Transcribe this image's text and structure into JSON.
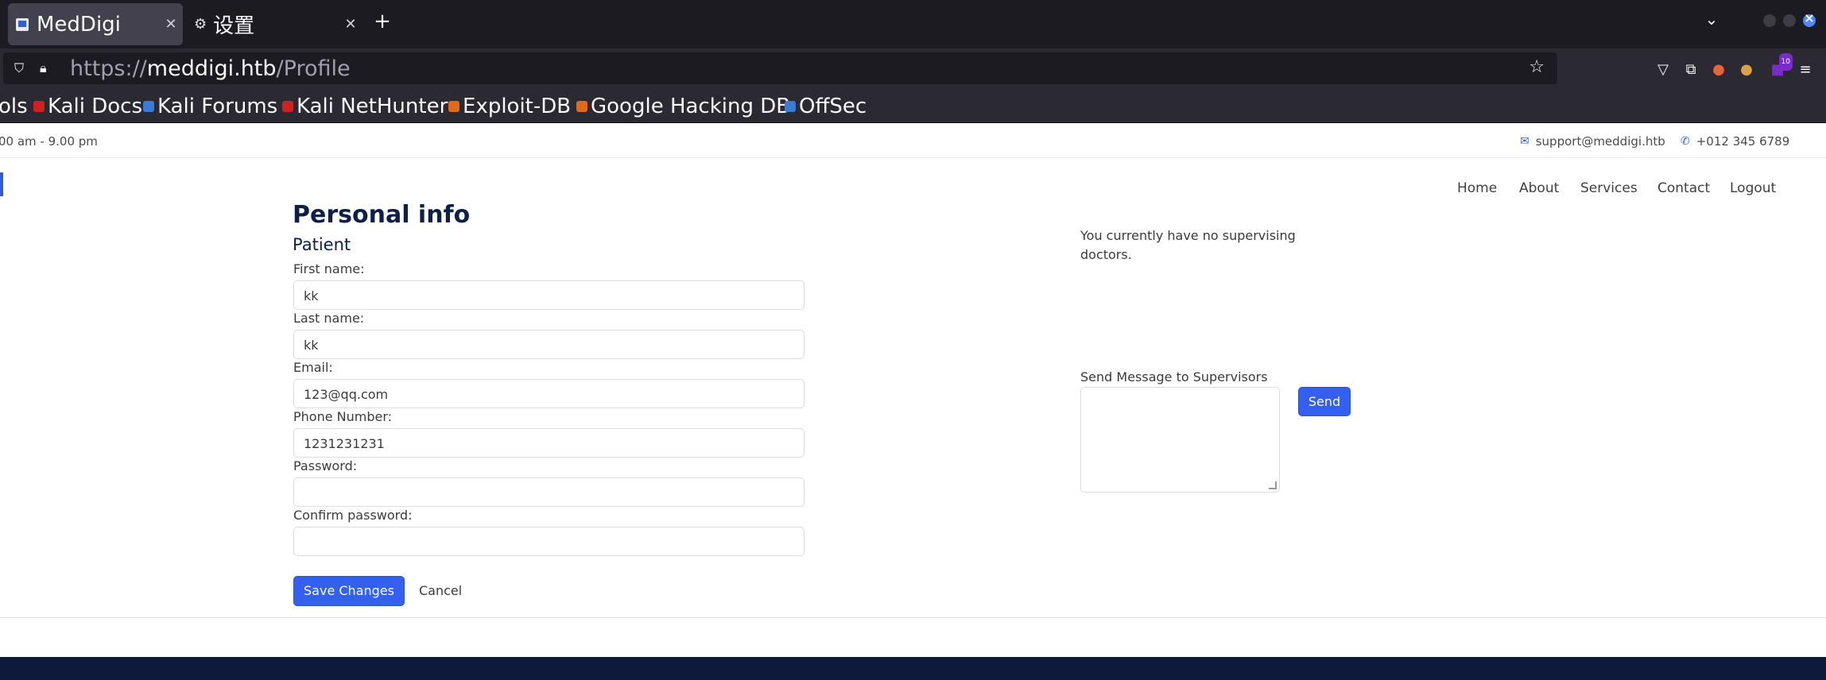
{
  "browser": {
    "tabs": [
      {
        "title": "MedDigi",
        "active": true
      },
      {
        "title": "设置",
        "active": false
      }
    ],
    "url_scheme": "https://",
    "url_host": "meddigi.htb",
    "url_path": "/Profile",
    "bookmarks": [
      {
        "label": "ols",
        "color": ""
      },
      {
        "label": "Kali Docs",
        "color": "#d02020"
      },
      {
        "label": "Kali Forums",
        "color": "#3a7bd5"
      },
      {
        "label": "Kali NetHunter",
        "color": "#d02020"
      },
      {
        "label": "Exploit-DB",
        "color": "#e06a1a"
      },
      {
        "label": "Google Hacking DB",
        "color": "#e06a1a"
      },
      {
        "label": "OffSec",
        "color": "#3a7bd5"
      }
    ]
  },
  "site": {
    "hours": "00 am - 9.00 pm",
    "email": "support@meddigi.htb",
    "phone": "+012 345 6789",
    "nav": [
      "Home",
      "About",
      "Services",
      "Contact",
      "Logout"
    ]
  },
  "profile": {
    "heading": "Personal info",
    "role": "Patient",
    "fields": [
      {
        "label": "First name:",
        "value": "kk"
      },
      {
        "label": "Last name:",
        "value": "kk"
      },
      {
        "label": "Email:",
        "value": "123@qq.com"
      },
      {
        "label": "Phone Number:",
        "value": "1231231231"
      },
      {
        "label": "Password:",
        "value": ""
      },
      {
        "label": "Confirm password:",
        "value": ""
      }
    ],
    "save_label": "Save Changes",
    "cancel_label": "Cancel"
  },
  "supervisors": {
    "status": "You currently have no supervising doctors.",
    "message_label": "Send Message to Supervisors",
    "message_value": "",
    "send_label": "Send"
  },
  "colors": {
    "accent": "#3360f0",
    "heading": "#0f1f4b",
    "footer": "#0e1a3c"
  }
}
